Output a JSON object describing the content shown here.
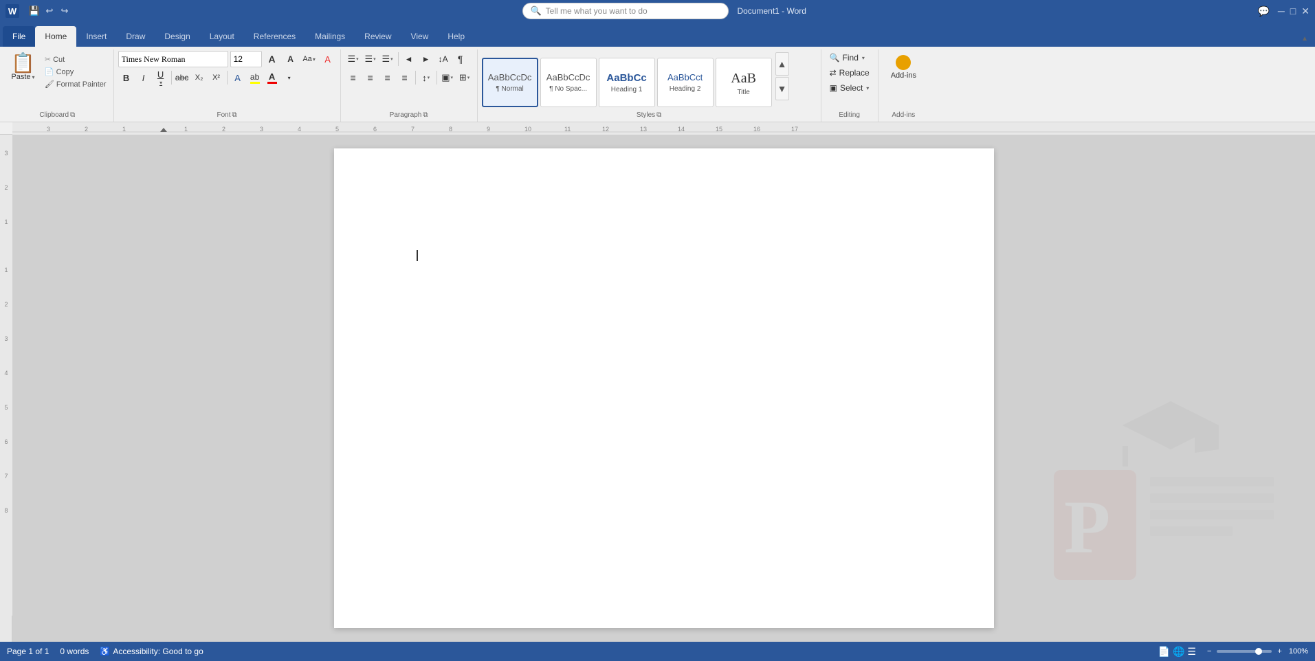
{
  "titlebar": {
    "app_icon": "W",
    "doc_title": "Document1 - Word",
    "tell_me_placeholder": "Tell me what you want to do",
    "chat_icon": "💬"
  },
  "ribbon_tabs": [
    {
      "id": "file",
      "label": "File"
    },
    {
      "id": "home",
      "label": "Home",
      "active": true
    },
    {
      "id": "insert",
      "label": "Insert"
    },
    {
      "id": "draw",
      "label": "Draw"
    },
    {
      "id": "design",
      "label": "Design"
    },
    {
      "id": "layout",
      "label": "Layout"
    },
    {
      "id": "references",
      "label": "References"
    },
    {
      "id": "mailings",
      "label": "Mailings"
    },
    {
      "id": "review",
      "label": "Review"
    },
    {
      "id": "view",
      "label": "View"
    },
    {
      "id": "help",
      "label": "Help"
    }
  ],
  "clipboard": {
    "group_label": "Clipboard",
    "paste_label": "Paste",
    "cut_label": "Cut",
    "copy_label": "Copy",
    "format_painter_label": "Format Painter",
    "paste_icon": "📋",
    "cut_icon": "✂",
    "copy_icon": "📄",
    "painter_icon": "🖌"
  },
  "font": {
    "group_label": "Font",
    "font_name": "Times New Roman",
    "font_size": "12",
    "grow_label": "A",
    "shrink_label": "A",
    "case_label": "Aa",
    "clear_label": "A",
    "bold_label": "B",
    "italic_label": "I",
    "underline_label": "U",
    "strikethrough_label": "abc",
    "subscript_label": "X₂",
    "superscript_label": "X²",
    "font_color_label": "A",
    "highlight_label": "ab"
  },
  "paragraph": {
    "group_label": "Paragraph",
    "bullets_label": "≡",
    "numbering_label": "≡",
    "multilevel_label": "≡",
    "decrease_indent_label": "◄",
    "increase_indent_label": "►",
    "sort_label": "↕",
    "show_para_label": "¶",
    "align_left_label": "≡",
    "align_center_label": "≡",
    "align_right_label": "≡",
    "justify_label": "≡",
    "line_spacing_label": "↕",
    "shading_label": "▣",
    "borders_label": "□"
  },
  "styles": {
    "group_label": "Styles",
    "items": [
      {
        "id": "normal",
        "label": "¶ Normal",
        "preview": "AaBbCcDc",
        "active": true
      },
      {
        "id": "no-spacing",
        "label": "¶ No Spac...",
        "preview": "AaBbCcDc"
      },
      {
        "id": "heading1",
        "label": "Heading 1",
        "preview": "AaBbCc"
      },
      {
        "id": "heading2",
        "label": "Heading 2",
        "preview": "AaBbCct"
      },
      {
        "id": "title",
        "label": "Title",
        "preview": "AaB"
      }
    ]
  },
  "editing": {
    "group_label": "Editing",
    "find_label": "Find",
    "replace_label": "Replace",
    "select_label": "Select"
  },
  "addins": {
    "group_label": "Add-ins",
    "label": "Add-ins"
  },
  "status_bar": {
    "page_info": "Page 1 of 1",
    "words": "0 words",
    "accessibility": "Accessibility: Good to go",
    "zoom": "100%"
  }
}
